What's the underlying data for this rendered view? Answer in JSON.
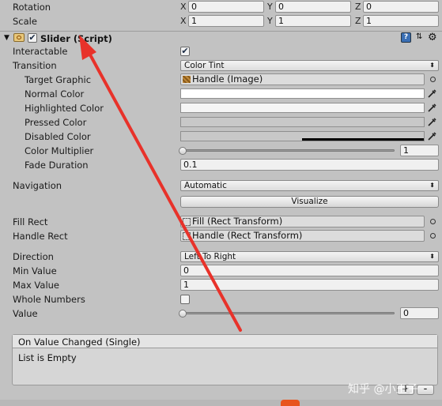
{
  "transform": {
    "rotation": {
      "label": "Rotation",
      "x": "0",
      "y": "0",
      "z": "0"
    },
    "scale": {
      "label": "Scale",
      "x": "1",
      "y": "1",
      "z": "1"
    },
    "axis_x": "X",
    "axis_y": "Y",
    "axis_z": "Z"
  },
  "component": {
    "title": "Slider (Script)",
    "enabled": true
  },
  "fields": {
    "interactable": {
      "label": "Interactable",
      "checked": true,
      "mark": "✔"
    },
    "transition": {
      "label": "Transition",
      "value": "Color Tint"
    },
    "target_graphic": {
      "label": "Target Graphic",
      "value": "Handle (Image)"
    },
    "normal_color": {
      "label": "Normal Color",
      "color": "#ffffff"
    },
    "highlighted_color": {
      "label": "Highlighted Color",
      "color": "#f5f5f5"
    },
    "pressed_color": {
      "label": "Pressed Color",
      "color": "#c8c8c8"
    },
    "disabled_color": {
      "label": "Disabled Color",
      "color": "#c8c8c8"
    },
    "color_multiplier": {
      "label": "Color Multiplier",
      "value": "1",
      "fraction": 0
    },
    "fade_duration": {
      "label": "Fade Duration",
      "value": "0.1"
    },
    "navigation": {
      "label": "Navigation",
      "value": "Automatic"
    },
    "visualize": {
      "label": "Visualize"
    },
    "fill_rect": {
      "label": "Fill Rect",
      "value": "Fill (Rect Transform)"
    },
    "handle_rect": {
      "label": "Handle Rect",
      "value": "Handle (Rect Transform)"
    },
    "direction": {
      "label": "Direction",
      "value": "Left To Right"
    },
    "min_value": {
      "label": "Min Value",
      "value": "0"
    },
    "max_value": {
      "label": "Max Value",
      "value": "1"
    },
    "whole_numbers": {
      "label": "Whole Numbers",
      "checked": false
    },
    "value": {
      "label": "Value",
      "value": "0",
      "fraction": 0
    }
  },
  "event": {
    "title": "On Value Changed (Single)",
    "empty": "List is Empty"
  },
  "watermark": "知乎 @小王子",
  "colors": {
    "arrow": "#e8322a",
    "panel_bg": "#c2c2c2"
  }
}
